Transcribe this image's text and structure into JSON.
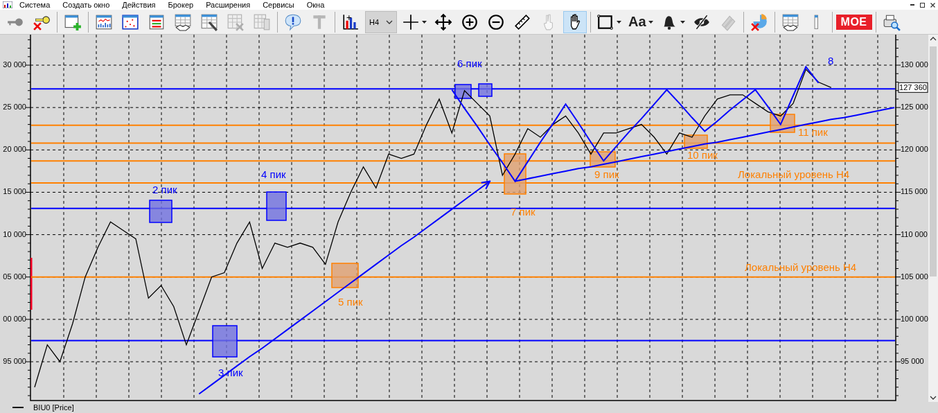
{
  "menu": [
    "Система",
    "Создать окно",
    "Действия",
    "Брокер",
    "Расширения",
    "Сервисы",
    "Окна"
  ],
  "toolbar_groups": [
    {
      "tools": [
        {
          "kind": "key",
          "selected": false,
          "disabled": false
        },
        {
          "kind": "key-remove",
          "selected": false,
          "disabled": false
        }
      ]
    },
    {
      "tools": [
        {
          "kind": "new-window",
          "selected": false,
          "disabled": false
        }
      ]
    },
    {
      "tools": [
        {
          "kind": "chart-window",
          "selected": false,
          "disabled": false
        },
        {
          "kind": "scatter-window",
          "selected": false,
          "disabled": false
        },
        {
          "kind": "list-window",
          "selected": false,
          "disabled": false
        },
        {
          "kind": "deals-table",
          "selected": false,
          "disabled": false
        },
        {
          "kind": "settings-table",
          "selected": false,
          "disabled": false
        },
        {
          "kind": "remove-table",
          "selected": false,
          "disabled": true
        },
        {
          "kind": "tables",
          "selected": false,
          "disabled": true
        }
      ]
    },
    {
      "tools": [
        {
          "kind": "info",
          "selected": false,
          "disabled": false
        },
        {
          "kind": "text-tool",
          "selected": false,
          "disabled": true
        }
      ]
    },
    {
      "tools": [
        {
          "kind": "chart-type",
          "selected": false,
          "disabled": false
        },
        {
          "kind": "timeframe",
          "label": "H4",
          "selected": false,
          "disabled": false
        },
        {
          "kind": "crosshair",
          "selected": false,
          "disabled": false
        },
        {
          "kind": "move",
          "selected": false,
          "disabled": false
        },
        {
          "kind": "zoom-in",
          "selected": false,
          "disabled": false
        },
        {
          "kind": "zoom-out",
          "selected": false,
          "disabled": false
        },
        {
          "kind": "ruler",
          "selected": false,
          "disabled": false
        },
        {
          "kind": "fingers",
          "selected": false,
          "disabled": true
        },
        {
          "kind": "hand",
          "selected": true,
          "disabled": false
        }
      ]
    },
    {
      "tools": [
        {
          "kind": "rectangle",
          "selected": false,
          "disabled": false
        },
        {
          "kind": "text",
          "label": "Aa",
          "selected": false,
          "disabled": false
        },
        {
          "kind": "alerts",
          "selected": false,
          "disabled": false
        },
        {
          "kind": "hide",
          "selected": false,
          "disabled": false
        },
        {
          "kind": "pencils",
          "selected": false,
          "disabled": true
        }
      ]
    },
    {
      "tools": [
        {
          "kind": "remove-chart",
          "selected": false,
          "disabled": false
        }
      ]
    },
    {
      "tools": [
        {
          "kind": "trades",
          "selected": false,
          "disabled": false
        },
        {
          "kind": "partial",
          "selected": false,
          "disabled": false
        }
      ]
    },
    {
      "tools": [
        {
          "kind": "exchange",
          "label": "MOE",
          "selected": false,
          "disabled": false
        }
      ]
    },
    {
      "tools": [
        {
          "kind": "print-preview",
          "selected": false,
          "disabled": false
        }
      ]
    }
  ],
  "chart": {
    "last_price": "127 360",
    "left_tick_labels": [
      "30 000",
      "25 000",
      "20 000",
      "15 000",
      "10 000",
      "05 000",
      "00 000",
      "95 000"
    ],
    "labels": [
      {
        "text": "2 пик",
        "color": "#0000ff"
      },
      {
        "text": "3 пик",
        "color": "#0000ff"
      },
      {
        "text": "4 пик",
        "color": "#0000ff"
      },
      {
        "text": "5 пик",
        "color": "#ff8000"
      },
      {
        "text": "6 пик",
        "color": "#0000ff"
      },
      {
        "text": "7 пик",
        "color": "#ff8000"
      },
      {
        "text": "9 пик",
        "color": "#ff8000"
      },
      {
        "text": "10 пик",
        "color": "#ff8000"
      },
      {
        "text": "11 пик",
        "color": "#ff8000"
      },
      {
        "text": "8",
        "color": "#0000ff"
      },
      {
        "text": "Локальный уровень H4",
        "color": "#ff8000"
      },
      {
        "text": "Локальный уровень H4",
        "color": "#ff8000"
      }
    ],
    "chart_data": {
      "type": "line",
      "grid": true,
      "ylim": [
        90260,
        133600
      ],
      "yticks": [
        {
          "value": 95000,
          "label": "95 000"
        },
        {
          "value": 100000,
          "label": "100 000"
        },
        {
          "value": 105000,
          "label": "105 000"
        },
        {
          "value": 110000,
          "label": "110 000"
        },
        {
          "value": 115000,
          "label": "115 000"
        },
        {
          "value": 120000,
          "label": "120 000"
        },
        {
          "value": 125000,
          "label": "125 000"
        },
        {
          "value": 130000,
          "label": "130 000"
        }
      ],
      "series": [
        {
          "name": "BIU0 [Price]",
          "color": "#000000",
          "values": [
            92000,
            97000,
            95000,
            99500,
            105000,
            108500,
            111500,
            110500,
            109500,
            102500,
            104000,
            101500,
            97000,
            101000,
            105000,
            105500,
            109000,
            111500,
            106000,
            109000,
            108500,
            109000,
            108500,
            106500,
            111500,
            115000,
            118000,
            115500,
            119500,
            119000,
            119500,
            123000,
            126000,
            122000,
            127000,
            125500,
            124000,
            117000,
            119500,
            122500,
            121500,
            123000,
            124000,
            122000,
            119500,
            122000,
            122000,
            122500,
            123000,
            121500,
            119500,
            122000,
            121500,
            124000,
            126000,
            126500,
            126500,
            125500,
            124500,
            124000,
            125500,
            129500,
            128000,
            127360,
            null,
            null,
            null,
            null,
            null
          ]
        },
        {
          "color": "#0000ff",
          "values": [
            null,
            null,
            null,
            null,
            null,
            null,
            null,
            null,
            null,
            null,
            null,
            null,
            null,
            91200,
            92300,
            93400,
            94500,
            95600,
            96600,
            97700,
            98800,
            99900,
            101000,
            102100,
            103200,
            104300,
            105400,
            106500,
            107600,
            108700,
            109700,
            110800,
            111900,
            113000,
            114100,
            115200,
            116300,
            null,
            null,
            null,
            null,
            null,
            null,
            null,
            null,
            null,
            null,
            null,
            null,
            null,
            null,
            null,
            null,
            null,
            null,
            null,
            null,
            null,
            null,
            null,
            null,
            null,
            null,
            null,
            null,
            null,
            null,
            null,
            null
          ]
        },
        {
          "color": "#0000ff",
          "values": [
            null,
            null,
            null,
            null,
            null,
            null,
            null,
            null,
            null,
            null,
            null,
            null,
            null,
            null,
            null,
            null,
            null,
            null,
            null,
            null,
            null,
            null,
            null,
            null,
            null,
            null,
            null,
            null,
            null,
            null,
            null,
            null,
            null,
            127100,
            124900,
            122800,
            120600,
            118500,
            116300,
            118600,
            120900,
            123100,
            125400,
            123200,
            120900,
            118700,
            120400,
            122100,
            123700,
            125400,
            127100,
            125500,
            123800,
            122200,
            123400,
            124700,
            125900,
            127100,
            125100,
            123000,
            126400,
            129800,
            127900,
            null,
            null,
            null,
            null,
            null,
            null
          ]
        },
        {
          "color": "#0000ff",
          "values": [
            null,
            null,
            null,
            null,
            null,
            null,
            null,
            null,
            null,
            null,
            null,
            null,
            null,
            null,
            null,
            null,
            null,
            null,
            null,
            null,
            null,
            null,
            null,
            null,
            null,
            null,
            null,
            null,
            null,
            null,
            null,
            null,
            null,
            null,
            null,
            null,
            null,
            null,
            116300,
            116600,
            116900,
            117200,
            117500,
            117800,
            118000,
            118300,
            118600,
            118900,
            119200,
            119500,
            119800,
            120100,
            120400,
            120700,
            120900,
            121200,
            121500,
            121800,
            122100,
            122400,
            122700,
            123000,
            123300,
            123600,
            123800,
            124100,
            124400,
            124700,
            125000
          ]
        }
      ],
      "ref_lines": [
        {
          "axis": "y",
          "value": 127200,
          "color": "#0000ff"
        },
        {
          "axis": "y",
          "value": 122900,
          "color": "#ff8000"
        },
        {
          "axis": "y",
          "value": 120800,
          "color": "#ff8000"
        },
        {
          "axis": "y",
          "value": 118700,
          "color": "#ff8000"
        },
        {
          "axis": "y",
          "value": 116100,
          "color": "#ff8000"
        },
        {
          "axis": "y",
          "value": 113100,
          "color": "#0000ff"
        },
        {
          "axis": "y",
          "value": 105000,
          "color": "#ff8000"
        },
        {
          "axis": "y",
          "value": 97500,
          "color": "#0000ff"
        }
      ]
    }
  }
}
